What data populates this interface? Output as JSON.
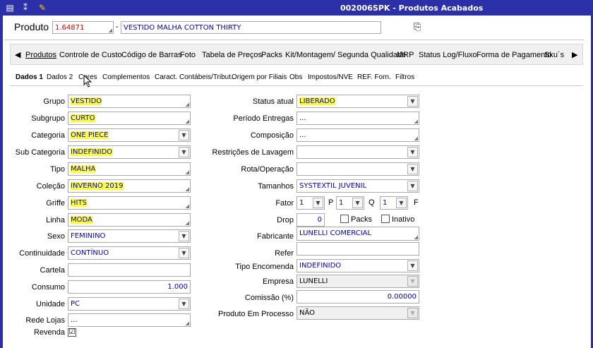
{
  "window": {
    "title": "002006SPK - Produtos Acabados"
  },
  "product": {
    "label": "Produto",
    "code": "1.64871",
    "dash": "-",
    "description": "VESTIDO MALHA COTTON THIRTY"
  },
  "tabs": [
    "Produtos",
    "Controle de Custo",
    "Código de Barras",
    "Foto",
    "Tabela de Preços",
    "Packs",
    "Kit/Montagem/ Segunda Qualidade",
    "MRP",
    "Status Log/Fluxo",
    "Forma de Pagamento",
    "Sku´s"
  ],
  "subtabs": [
    "Dados 1",
    "Dados 2",
    "Cores",
    "Complementos",
    "Caract. Contábeis/Tribut.",
    "Origem por Filiais",
    "Obs",
    "Impostos/NVE",
    "REF. Forn.",
    "Filtros"
  ],
  "left": {
    "grupo": {
      "label": "Grupo",
      "value": "VESTIDO"
    },
    "subgrupo": {
      "label": "Subgrupo",
      "value": "CURTO"
    },
    "categoria": {
      "label": "Categoria",
      "value": "ONE PIECE"
    },
    "subcategoria": {
      "label": "Sub Categoria",
      "value": "INDEFINIDO"
    },
    "tipo": {
      "label": "Tipo",
      "value": "MALHA"
    },
    "colecao": {
      "label": "Coleção",
      "value": "INVERNO 2019"
    },
    "griffe": {
      "label": "Griffe",
      "value": "HITS"
    },
    "linha": {
      "label": "Linha",
      "value": "MODA"
    },
    "sexo": {
      "label": "Sexo",
      "value": "FEMININO"
    },
    "continuidade": {
      "label": "Continuidade",
      "value": "CONTÍNUO"
    },
    "cartela": {
      "label": "Cartela",
      "value": ""
    },
    "consumo": {
      "label": "Consumo",
      "value": "1.000"
    },
    "unidade": {
      "label": "Unidade",
      "value": "PC"
    },
    "redelojas": {
      "label": "Rede Lojas",
      "value": "..."
    },
    "revenda": {
      "label": "Revenda",
      "checked": "☑"
    }
  },
  "right": {
    "status": {
      "label": "Status atual",
      "value": "LIBERADO"
    },
    "periodo": {
      "label": "Período Entregas",
      "value": "..."
    },
    "composicao": {
      "label": "Composição",
      "value": "..."
    },
    "restricoes": {
      "label": "Restrições de Lavagem",
      "value": ""
    },
    "rota": {
      "label": "Rota/Operação",
      "value": ""
    },
    "tamanhos": {
      "label": "Tamanhos",
      "value": "SYSTEXTIL JUVENIL"
    },
    "fator": {
      "label": "Fator",
      "f1": "1",
      "p": "P",
      "f2": "1",
      "q": "Q",
      "f3": "1",
      "f": "F"
    },
    "drop": {
      "label": "Drop",
      "value": "0",
      "packs": "Packs",
      "inativo": "Inativo"
    },
    "fabricante": {
      "label": "Fabricante",
      "value": "LUNELLI COMERCIAL"
    },
    "refer": {
      "label": "Refer",
      "value": ""
    },
    "tipoenc": {
      "label": "Tipo Encomenda",
      "value": "INDEFINIDO"
    },
    "empresa": {
      "label": "Empresa",
      "value": "LUNELLI"
    },
    "comissao": {
      "label": "Comissão (%)",
      "value": "0.00000"
    },
    "emprocesso": {
      "label": "Produto Em Processo",
      "value": "NÃO"
    }
  }
}
